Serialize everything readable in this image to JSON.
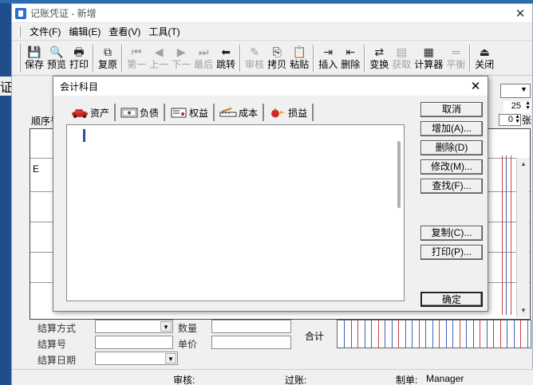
{
  "window": {
    "title": "记账凭证 - 新增",
    "close_glyph": "✕"
  },
  "menu": [
    "文件(F)",
    "编辑(E)",
    "查看(V)",
    "工具(T)"
  ],
  "toolbar": [
    {
      "label": "保存",
      "icon": "💾",
      "disabled": false
    },
    {
      "label": "预览",
      "icon": "🔍",
      "disabled": false
    },
    {
      "label": "打印",
      "icon": "🖶",
      "disabled": false
    },
    {
      "sep": true
    },
    {
      "label": "复原",
      "icon": "⧉",
      "disabled": false
    },
    {
      "sep": true
    },
    {
      "label": "第一",
      "icon": "⏮",
      "disabled": true
    },
    {
      "label": "上一",
      "icon": "◀",
      "disabled": true
    },
    {
      "label": "下一",
      "icon": "▶",
      "disabled": true
    },
    {
      "label": "最后",
      "icon": "⏭",
      "disabled": true
    },
    {
      "label": "跳转",
      "icon": "⬅",
      "disabled": false
    },
    {
      "sep": true
    },
    {
      "label": "审核",
      "icon": "✎",
      "disabled": true
    },
    {
      "label": "拷贝",
      "icon": "⎘",
      "disabled": false
    },
    {
      "label": "粘贴",
      "icon": "📋",
      "disabled": false
    },
    {
      "sep": true
    },
    {
      "label": "插入",
      "icon": "⇥",
      "disabled": false
    },
    {
      "label": "删除",
      "icon": "⇤",
      "disabled": false
    },
    {
      "sep": true
    },
    {
      "label": "变换",
      "icon": "⇄",
      "disabled": false
    },
    {
      "label": "获取",
      "icon": "▤",
      "disabled": true
    },
    {
      "label": "计算器",
      "icon": "▦",
      "disabled": false
    },
    {
      "label": "平衡",
      "icon": "═",
      "disabled": true
    },
    {
      "sep": true
    },
    {
      "label": "关闭",
      "icon": "⏏",
      "disabled": false
    }
  ],
  "peek_text": "证",
  "form": {
    "seq_label": "顺序号:",
    "spin1_value": "25",
    "spin2_value": "0",
    "sheets_label": "张",
    "row_e": "E"
  },
  "bottom": {
    "settle_method": "结算方式",
    "settle_no": "结算号",
    "settle_date": "结算日期",
    "qty": "数量",
    "price": "单价",
    "total": "合计"
  },
  "status": {
    "audit": "审核:",
    "posting": "过账:",
    "maker": "制单:",
    "maker_value": "Manager"
  },
  "dialog": {
    "title": "会计科目",
    "close_glyph": "✕",
    "tabs": [
      "资产",
      "负债",
      "权益",
      "成本",
      "损益"
    ],
    "buttons": {
      "cancel": "取消",
      "add": "增加(A)...",
      "delete": "删除(D)",
      "edit": "修改(M)...",
      "find": "查找(F)...",
      "copy": "复制(C)...",
      "print": "打印(P)...",
      "ok": "确定"
    }
  },
  "colors": {
    "accent": "#2a6ed0",
    "grid_red": "#d04040",
    "grid_blue": "#4060c0"
  }
}
